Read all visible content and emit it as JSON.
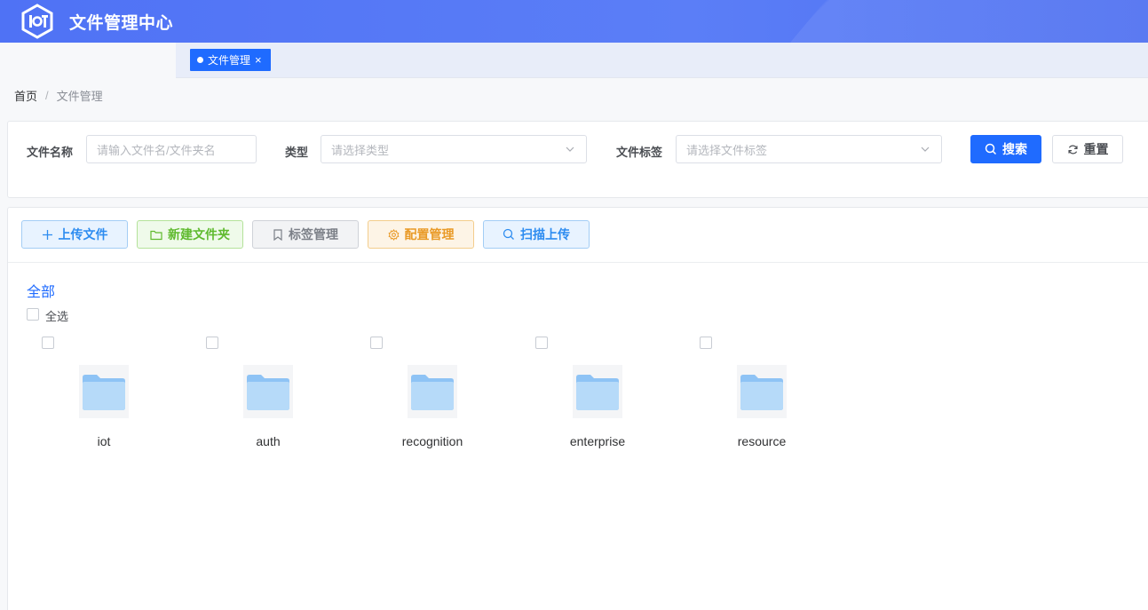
{
  "header": {
    "title": "文件管理中心",
    "logo_text": "IoT",
    "colors": {
      "gradient_start": "#4f72f5",
      "gradient_end": "#4d6ff0"
    }
  },
  "tags": [
    {
      "label": "文件管理",
      "active": true,
      "close_icon": "close-icon"
    }
  ],
  "breadcrumb": {
    "home": "首页",
    "separator": "/",
    "current": "文件管理"
  },
  "search": {
    "file_name_label": "文件名称",
    "file_name_placeholder": "请输入文件名/文件夹名",
    "type_label": "类型",
    "type_placeholder": "请选择类型",
    "tag_label": "文件标签",
    "tag_placeholder": "请选择文件标签",
    "search_button": "搜索",
    "reset_button": "重置"
  },
  "toolbar": {
    "upload": "上传文件",
    "new_folder": "新建文件夹",
    "tag_manage": "标签管理",
    "config_manage": "配置管理",
    "scan_upload": "扫描上传"
  },
  "content": {
    "path": "全部",
    "select_all": "全选",
    "folders": [
      {
        "name": "iot"
      },
      {
        "name": "auth"
      },
      {
        "name": "recognition"
      },
      {
        "name": "enterprise"
      },
      {
        "name": "resource"
      }
    ]
  },
  "colors": {
    "primary": "#1f6bff",
    "success": "#5fba2e",
    "warning": "#e99a27",
    "info": "#2d8cf0"
  }
}
